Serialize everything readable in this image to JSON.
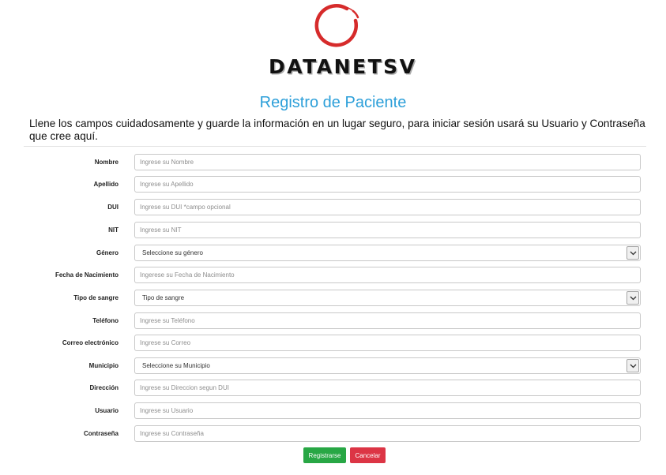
{
  "logo": {
    "text": "DATANETSV",
    "accent_color": "#d62b2b"
  },
  "page_title": "Registro de Paciente",
  "intro": "Llene los campos cuidadosamente y guarde la información en un lugar seguro, para iniciar sesión usará su Usuario y Contraseña que cree aquí.",
  "form": {
    "nombre": {
      "label": "Nombre",
      "placeholder": "Ingrese su Nombre"
    },
    "apellido": {
      "label": "Apellido",
      "placeholder": "Ingrese su Apellido"
    },
    "dui": {
      "label": "DUI",
      "placeholder": "Ingrese su DUI *campo opcional"
    },
    "nit": {
      "label": "NIT",
      "placeholder": "Ingrese su NIT"
    },
    "genero": {
      "label": "Género",
      "selected": "Seleccione su género"
    },
    "fecha_nacimiento": {
      "label": "Fecha de Nacimiento",
      "placeholder": "Ingerese su Fecha de Nacimiento"
    },
    "tipo_sangre": {
      "label": "Tipo de sangre",
      "selected": "Tipo de sangre"
    },
    "telefono": {
      "label": "Teléfono",
      "placeholder": "Ingrese su Teléfono"
    },
    "correo": {
      "label": "Correo electrónico",
      "placeholder": "Ingrese su Correo"
    },
    "municipio": {
      "label": "Municipio",
      "selected": "Seleccione su Municipio"
    },
    "direccion": {
      "label": "Dirección",
      "placeholder": "Ingrese su Direccion segun DUI"
    },
    "usuario": {
      "label": "Usuario",
      "placeholder": "Ingrese su Usuario"
    },
    "contrasena": {
      "label": "Contraseña",
      "placeholder": "Ingrese su Contraseña"
    }
  },
  "buttons": {
    "submit": "Registrarse",
    "cancel": "Cancelar"
  },
  "colors": {
    "title": "#2c9fd9",
    "submit": "#28a745",
    "cancel": "#dc3545"
  }
}
